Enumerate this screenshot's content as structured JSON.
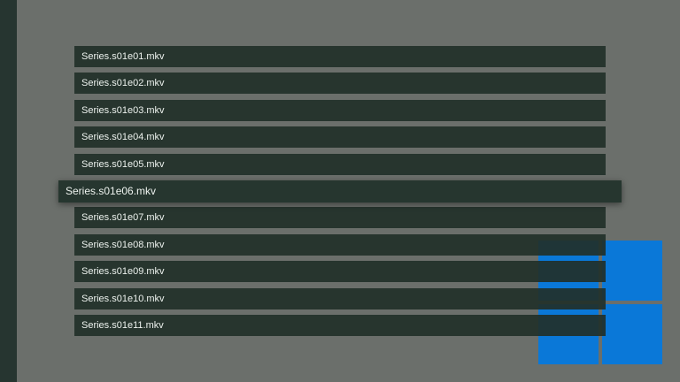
{
  "logo": {
    "name": "windows-logo",
    "color": "#0a78d8"
  },
  "files": {
    "items": [
      {
        "label": "Series.s01e01.mkv"
      },
      {
        "label": "Series.s01e02.mkv"
      },
      {
        "label": "Series.s01e03.mkv"
      },
      {
        "label": "Series.s01e04.mkv"
      },
      {
        "label": "Series.s01e05.mkv"
      },
      {
        "label": "Series.s01e06.mkv"
      },
      {
        "label": "Series.s01e07.mkv"
      },
      {
        "label": "Series.s01e08.mkv"
      },
      {
        "label": "Series.s01e09.mkv"
      },
      {
        "label": "Series.s01e10.mkv"
      },
      {
        "label": "Series.s01e11.mkv"
      }
    ],
    "selected_index": 5
  },
  "colors": {
    "background": "#6b6f6b",
    "rail": "#263530",
    "row": "#223029",
    "text": "#eef3ef"
  }
}
